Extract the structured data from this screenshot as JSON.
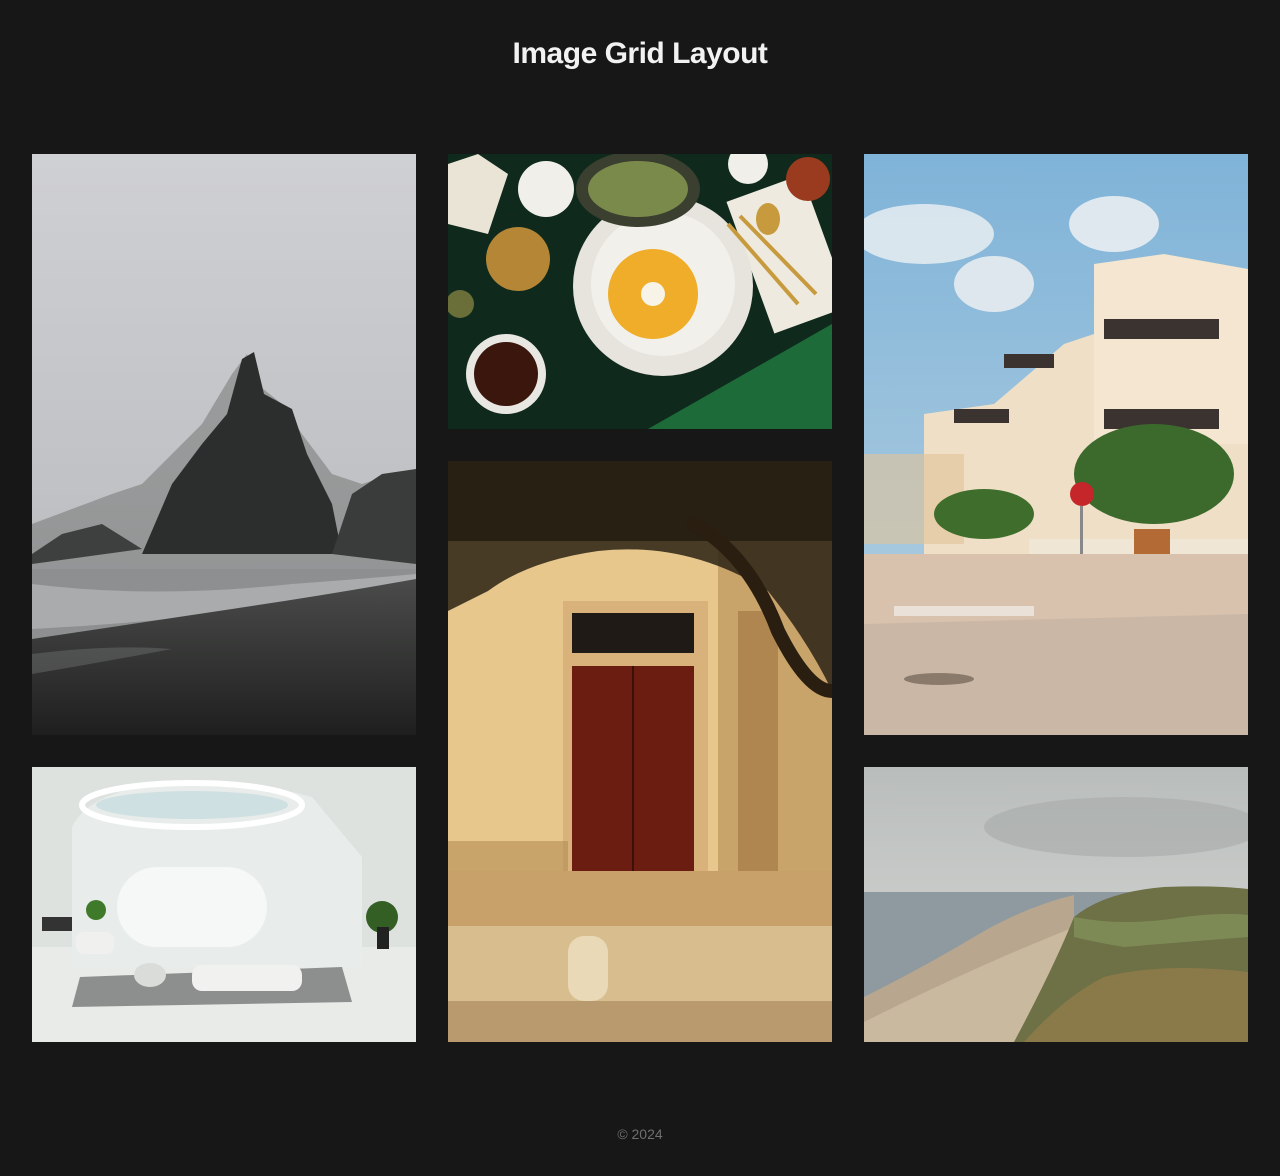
{
  "header": {
    "title": "Image Grid Layout"
  },
  "grid": {
    "images": [
      {
        "subject": "foggy-sea-stack-beach"
      },
      {
        "subject": "table-setting-with-soup"
      },
      {
        "subject": "seaside-apartment-buildings"
      },
      {
        "subject": "white-minimal-living-room"
      },
      {
        "subject": "red-wooden-door-facade"
      },
      {
        "subject": "coastal-dunes-beach"
      }
    ]
  },
  "footer": {
    "copyright": "© 2024"
  },
  "colors": {
    "background": "#171717",
    "title": "#f2f2f2",
    "footer": "#6f6f6f"
  }
}
